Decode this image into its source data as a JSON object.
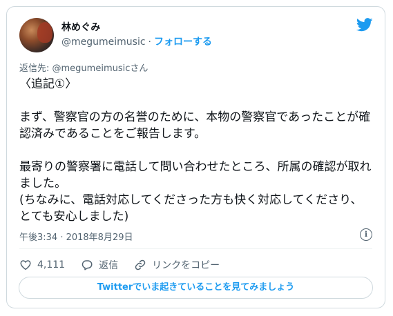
{
  "author": {
    "name": "林めぐみ",
    "handle": "@megumeimusic",
    "separator": "·",
    "follow_label": "フォローする"
  },
  "reply_to": {
    "prefix": "返信先: ",
    "mention": "@megumeimusic",
    "suffix": "さん"
  },
  "tweet": {
    "paragraphs": [
      "〈追記①〉",
      "",
      "まず、警察官の方の名誉のために、本物の警察官であったことが確認済みであることをご報告します。",
      "",
      "最寄りの警察署に電話して問い合わせたところ、所属の確認が取れました。\n(ちなみに、電話対応してくださった方も快く対応してくださり、とても安心しました)"
    ],
    "timestamp": "午後3:34 · 2018年8月29日"
  },
  "actions": {
    "like_count": "4,111",
    "reply_label": "返信",
    "copy_link_label": "リンクをコピー"
  },
  "cta": {
    "label": "Twitterでいま起きていることを見てみましょう"
  },
  "icons": {
    "bird": "twitter-bird-icon",
    "info": "info-icon",
    "like": "heart-icon",
    "reply": "reply-bubble-icon",
    "link": "link-icon"
  },
  "colors": {
    "accent": "#1d9bf0",
    "text": "#0f1419",
    "muted": "#536471",
    "border": "#cfd9de"
  }
}
